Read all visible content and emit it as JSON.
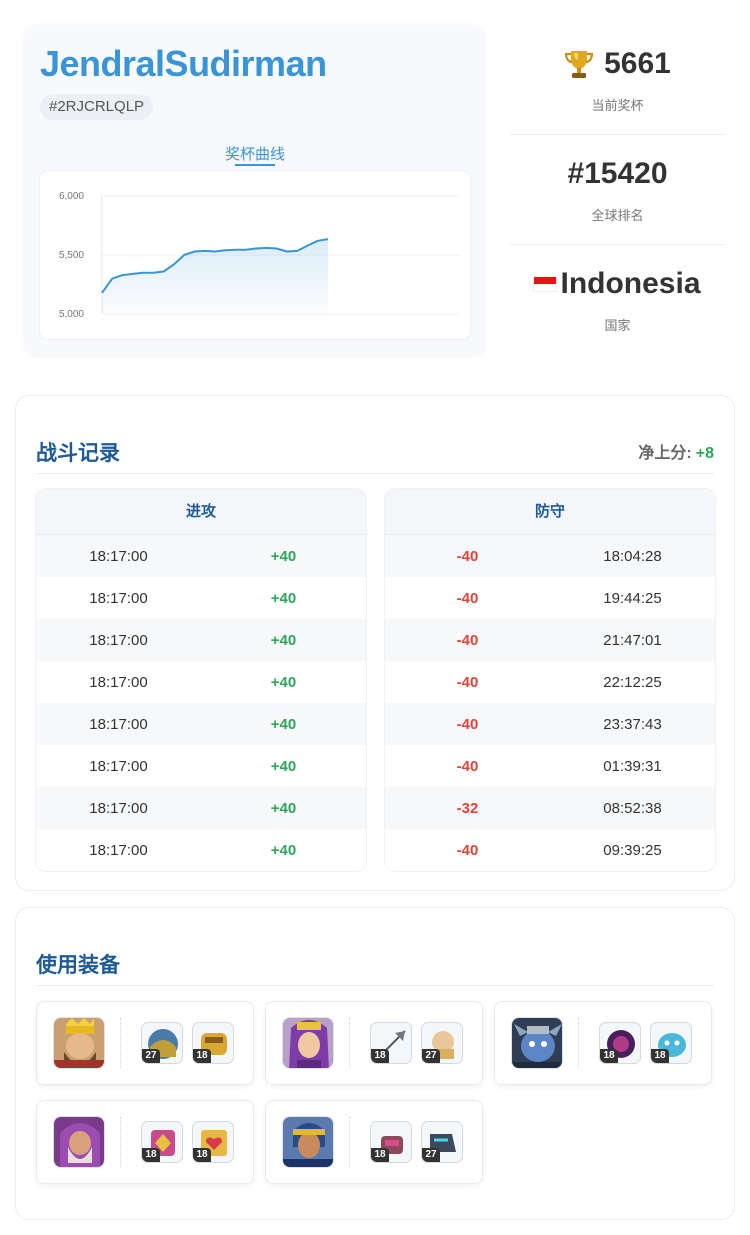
{
  "profile": {
    "name": "JendralSudirman",
    "tag": "#2RJCRLQLP",
    "chart_tab": "奖杯曲线"
  },
  "stats": [
    {
      "icon": "trophy-icon",
      "value": "5661",
      "label": "当前奖杯"
    },
    {
      "icon": null,
      "value": "#15420",
      "label": "全球排名"
    },
    {
      "icon": "indonesia-flag-icon",
      "value": "Indonesia",
      "label": "国家"
    }
  ],
  "chart_data": {
    "type": "line",
    "y_ticks": [
      "6,000",
      "5,500",
      "5,000"
    ],
    "ylim": [
      5000,
      6000
    ],
    "values": [
      5180,
      5300,
      5330,
      5340,
      5350,
      5350,
      5360,
      5420,
      5500,
      5530,
      5535,
      5530,
      5540,
      5545,
      5545,
      5555,
      5560,
      5555,
      5530,
      5535,
      5580,
      5620,
      5635
    ],
    "grid": true,
    "color": "#3a95d8"
  },
  "battles": {
    "title": "战斗记录",
    "net_label": "净上分:",
    "net_value": "+8",
    "attack": {
      "header": "进攻",
      "rows": [
        {
          "time": "18:17:00",
          "score": "+40"
        },
        {
          "time": "18:17:00",
          "score": "+40"
        },
        {
          "time": "18:17:00",
          "score": "+40"
        },
        {
          "time": "18:17:00",
          "score": "+40"
        },
        {
          "time": "18:17:00",
          "score": "+40"
        },
        {
          "time": "18:17:00",
          "score": "+40"
        },
        {
          "time": "18:17:00",
          "score": "+40"
        },
        {
          "time": "18:17:00",
          "score": "+40"
        }
      ]
    },
    "defense": {
      "header": "防守",
      "rows": [
        {
          "score": "-40",
          "time": "18:04:28"
        },
        {
          "score": "-40",
          "time": "19:44:25"
        },
        {
          "score": "-40",
          "time": "21:47:01"
        },
        {
          "score": "-40",
          "time": "22:12:25"
        },
        {
          "score": "-40",
          "time": "23:37:43"
        },
        {
          "score": "-40",
          "time": "01:39:31"
        },
        {
          "score": "-32",
          "time": "08:52:38"
        },
        {
          "score": "-40",
          "time": "09:39:25"
        }
      ]
    }
  },
  "equipment": {
    "title": "使用装备",
    "heroes": [
      {
        "hero": "barbarian-king-icon",
        "items": [
          {
            "icon": "earthquake-boots-icon",
            "level": "27"
          },
          {
            "icon": "giant-gauntlet-icon",
            "level": "18"
          }
        ]
      },
      {
        "hero": "archer-queen-icon",
        "items": [
          {
            "icon": "giant-arrow-icon",
            "level": "18"
          },
          {
            "icon": "healer-puppet-icon",
            "level": "27"
          }
        ]
      },
      {
        "hero": "minion-prince-icon",
        "items": [
          {
            "icon": "dark-orb-icon",
            "level": "18"
          },
          {
            "icon": "henchmen-puppet-icon",
            "level": "18"
          }
        ]
      },
      {
        "hero": "grand-warden-icon",
        "items": [
          {
            "icon": "rage-gem-icon",
            "level": "18"
          },
          {
            "icon": "healing-tome-icon",
            "level": "18"
          }
        ]
      },
      {
        "hero": "royal-champion-icon",
        "items": [
          {
            "icon": "rocket-spear-icon",
            "level": "18"
          },
          {
            "icon": "electro-boots-icon",
            "level": "27"
          }
        ]
      }
    ]
  }
}
